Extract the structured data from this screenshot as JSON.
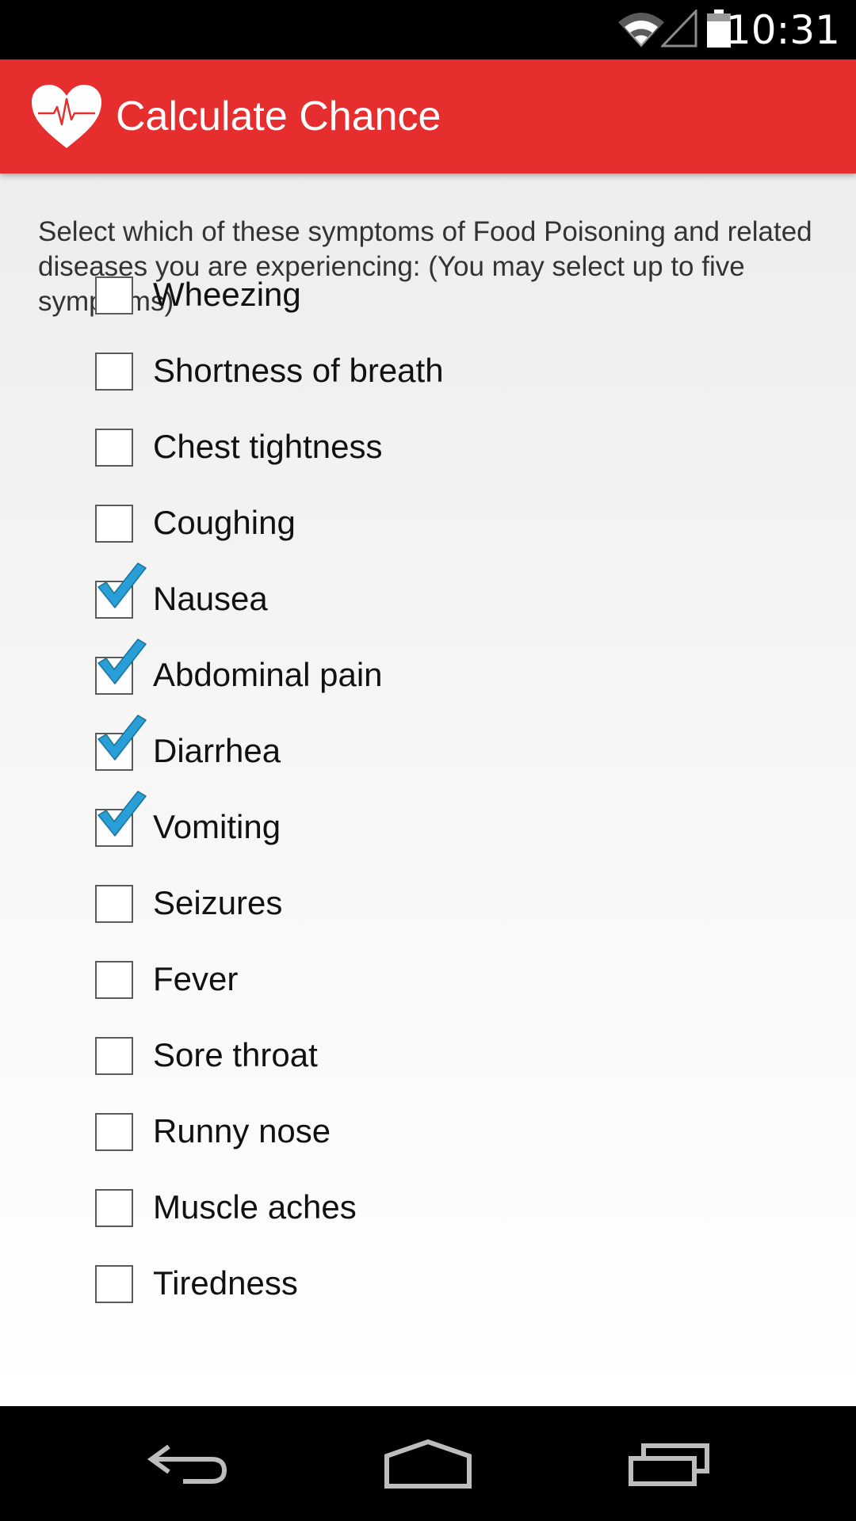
{
  "status_bar": {
    "time": "10:31",
    "icons": [
      "wifi-icon",
      "cell-signal-icon",
      "battery-icon"
    ]
  },
  "action_bar": {
    "icon": "heart-pulse-icon",
    "title": "Calculate Chance",
    "background_color": "#e62e2e"
  },
  "content": {
    "instructions": "Select which of these symptoms of Food Poisoning and related diseases you are experiencing: (You may select up to five symptoms)",
    "symptoms": [
      {
        "label": "Wheezing",
        "checked": false
      },
      {
        "label": "Shortness of breath",
        "checked": false
      },
      {
        "label": "Chest tightness",
        "checked": false
      },
      {
        "label": "Coughing",
        "checked": false
      },
      {
        "label": "Nausea",
        "checked": true
      },
      {
        "label": "Abdominal pain",
        "checked": true
      },
      {
        "label": "Diarrhea",
        "checked": true
      },
      {
        "label": "Vomiting",
        "checked": true
      },
      {
        "label": "Seizures",
        "checked": false
      },
      {
        "label": "Fever",
        "checked": false
      },
      {
        "label": "Sore throat",
        "checked": false
      },
      {
        "label": "Runny nose",
        "checked": false
      },
      {
        "label": "Muscle aches",
        "checked": false
      },
      {
        "label": "Tiredness",
        "checked": false
      }
    ],
    "check_color": "#2a9fd6"
  },
  "nav_bar": {
    "buttons": [
      "back-icon",
      "home-icon",
      "recents-icon"
    ]
  }
}
